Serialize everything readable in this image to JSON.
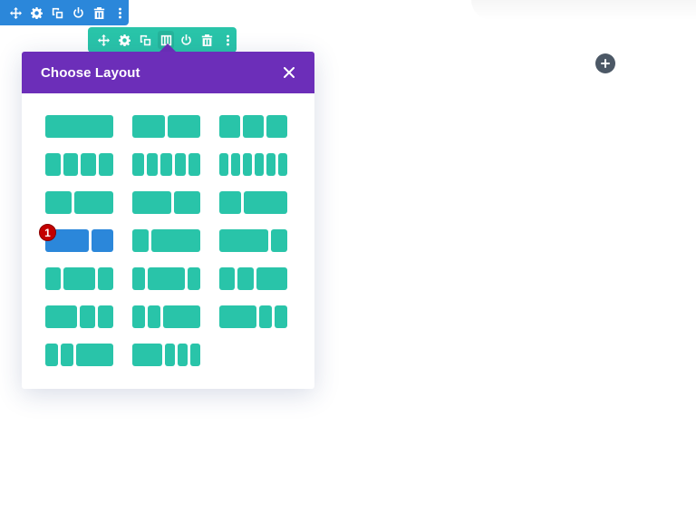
{
  "section_toolbar": {
    "color": "#2b87da",
    "icons": [
      "move-icon",
      "gear-icon",
      "duplicate-icon",
      "power-icon",
      "trash-icon",
      "more-icon"
    ]
  },
  "row_toolbar": {
    "color": "#29c4a9",
    "icons": [
      "move-icon",
      "gear-icon",
      "duplicate-icon",
      "columns-icon",
      "power-icon",
      "trash-icon",
      "more-icon"
    ]
  },
  "modal": {
    "title": "Choose Layout",
    "header_color": "#6c2eb9",
    "close_icon": "close-icon",
    "column_color": "#29c4a9",
    "selected_color": "#2b87da",
    "selected_badge": "1",
    "layouts": [
      {
        "id": "1",
        "cols": [
          1
        ]
      },
      {
        "id": "1_2,1_2",
        "cols": [
          1,
          1
        ]
      },
      {
        "id": "1_3,1_3,1_3",
        "cols": [
          1,
          1,
          1
        ]
      },
      {
        "id": "1_4x4",
        "cols": [
          1,
          1,
          1,
          1
        ]
      },
      {
        "id": "1_5x5",
        "cols": [
          1,
          1,
          1,
          1,
          1
        ]
      },
      {
        "id": "1_6x6",
        "cols": [
          1,
          1,
          1,
          1,
          1,
          1
        ]
      },
      {
        "id": "2_5,3_5",
        "cols": [
          2,
          3
        ]
      },
      {
        "id": "3_5,2_5",
        "cols": [
          3,
          2
        ]
      },
      {
        "id": "1_3,2_3",
        "cols": [
          1,
          2
        ]
      },
      {
        "id": "2_3,1_3",
        "cols": [
          2,
          1
        ],
        "selected": true
      },
      {
        "id": "1_4,3_4",
        "cols": [
          1,
          3
        ]
      },
      {
        "id": "3_4,1_4",
        "cols": [
          3,
          1
        ]
      },
      {
        "id": "1_4,1_2,1_4",
        "cols": [
          1,
          2,
          1
        ]
      },
      {
        "id": "1_5,3_5,1_5",
        "cols": [
          1,
          3,
          1
        ]
      },
      {
        "id": "1_4,1_4,1_2",
        "cols": [
          1,
          1,
          2
        ]
      },
      {
        "id": "1_2,1_4,1_4",
        "cols": [
          2,
          1,
          1
        ]
      },
      {
        "id": "1_5,1_5,3_5",
        "cols": [
          1,
          1,
          3
        ]
      },
      {
        "id": "3_5,1_5,1_5",
        "cols": [
          3,
          1,
          1
        ]
      },
      {
        "id": "1_6,1_6,1_6,1_2",
        "cols": [
          1,
          1,
          3
        ]
      },
      {
        "id": "1_2,1_6,1_6,1_6",
        "cols": [
          3,
          1,
          1,
          1
        ]
      }
    ]
  },
  "add_button": {
    "icon": "plus-icon",
    "color": "#4c5866"
  }
}
